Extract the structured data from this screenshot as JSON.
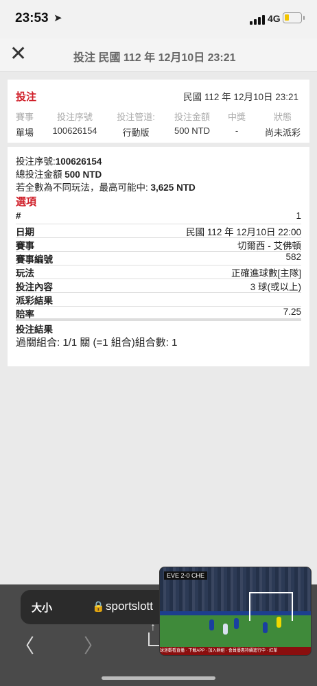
{
  "status_bar": {
    "time": "23:53",
    "network": "4G"
  },
  "header": {
    "title": "投注 民國 112 年 12月10日 23:21"
  },
  "summary": {
    "label": "投注",
    "date": "民國 112 年 12月10日 23:21",
    "columns": [
      {
        "header": "賽事",
        "value": "單場"
      },
      {
        "header": "投注序號",
        "value": "100626154"
      },
      {
        "header": "投注管道:",
        "value": "行動版"
      },
      {
        "header": "投注金額",
        "value": "500 NTD"
      },
      {
        "header": "中獎",
        "value": "-"
      },
      {
        "header": "狀態",
        "value": "尚未派彩"
      }
    ]
  },
  "detail": {
    "serial_label": "投注序號:",
    "serial_value": "100626154",
    "total_label": "總投注金額",
    "total_value": "500 NTD",
    "max_label": "若全數為不同玩法，最高可能中:",
    "max_value": "3,625 NTD",
    "options_label": "選項",
    "rows": [
      {
        "key": "#",
        "value": "1"
      },
      {
        "key": "日期",
        "value": "民國 112 年 12月10日 22:00"
      },
      {
        "key": "賽事",
        "value": "切爾西 - 艾佛頓"
      },
      {
        "key": "賽事編號",
        "value": "582"
      },
      {
        "key": "玩法",
        "value": "正確進球數[主隊]"
      },
      {
        "key": "投注內容",
        "value": "3 球(或以上)"
      },
      {
        "key": "派彩結果",
        "value": ""
      },
      {
        "key": "賠率",
        "value": "7.25"
      },
      {
        "key": "投注結果",
        "value": ""
      }
    ],
    "combo": "過關組合: 1/1 關 (=1 組合)組合數: 1"
  },
  "browser": {
    "text_size": "大小",
    "url": "sportslott"
  },
  "video": {
    "score": "EVE 2-0 CHE",
    "ticker": "球迷觀看直播 · 下載APP · 加入群組 · 會員優惠持續進行中 · 紅單"
  },
  "colors": {
    "accent": "#d0202a"
  }
}
